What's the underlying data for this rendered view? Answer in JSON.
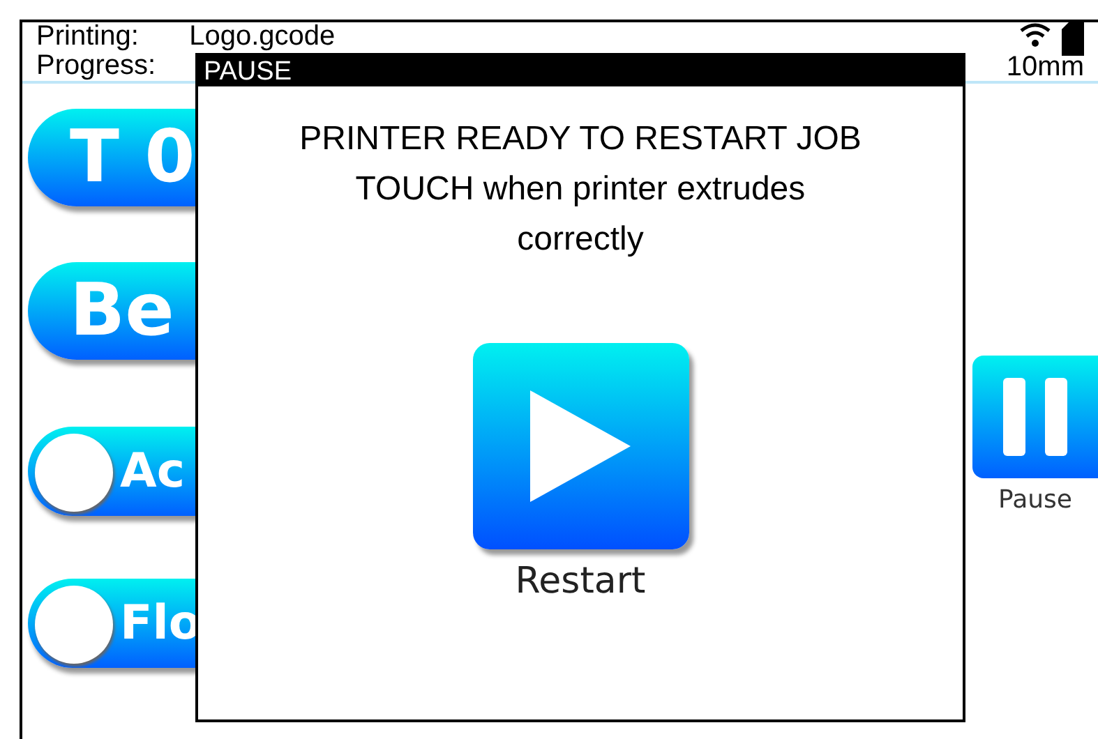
{
  "header": {
    "printing_label": "Printing:",
    "file_name": "Logo.gcode",
    "progress_label": "Progress:",
    "distance": "10mm"
  },
  "side_buttons": [
    {
      "kind": "button",
      "label": "T 0"
    },
    {
      "kind": "button",
      "label": "Be"
    },
    {
      "kind": "toggle",
      "label": "Ac",
      "on": false
    },
    {
      "kind": "toggle",
      "label": "Flo",
      "on": false
    }
  ],
  "pause_button": {
    "label": "Pause"
  },
  "dialog": {
    "title": "PAUSE",
    "message_lines": [
      "PRINTER READY TO RESTART JOB",
      "TOUCH when printer extrudes correctly"
    ],
    "button_label": "Restart"
  }
}
